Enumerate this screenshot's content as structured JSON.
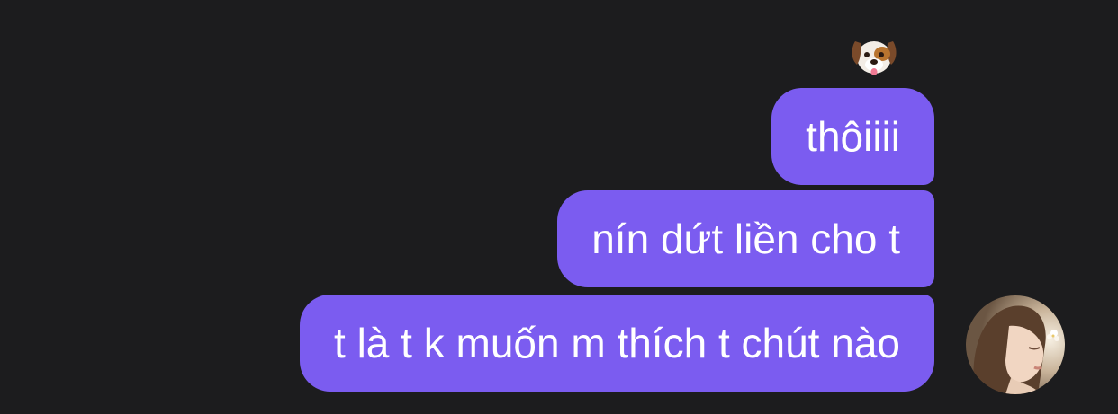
{
  "reaction": {
    "icon": "dog-face-emoji"
  },
  "messages": [
    {
      "text": "thôiiii"
    },
    {
      "text": "nín dứt liền cho t"
    },
    {
      "text": "t là t k muốn m thích t chút nào"
    }
  ],
  "colors": {
    "background": "#1c1c1e",
    "bubble": "#7b5cf0",
    "bubble_text": "#ffffff"
  },
  "avatar": {
    "icon": "user-avatar"
  }
}
